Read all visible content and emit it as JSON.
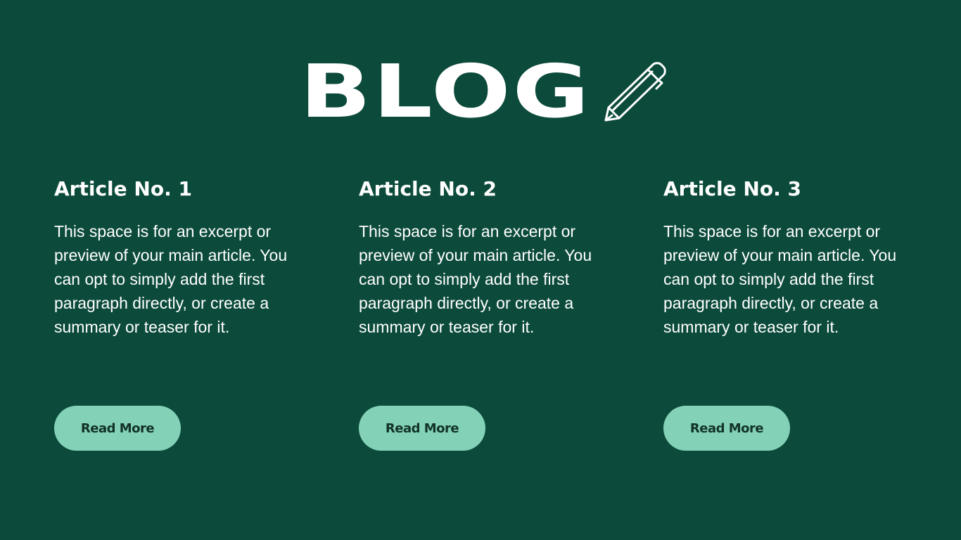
{
  "header": {
    "title": "BLOG",
    "icon": "pencil-icon"
  },
  "articles": [
    {
      "title": "Article No. 1",
      "excerpt": "This space is for an excerpt or preview of your main article. You can opt to simply add the first paragraph directly, or create a summary or teaser for it.",
      "button_label": "Read More"
    },
    {
      "title": "Article No. 2",
      "excerpt": "This space is for an excerpt or preview of your main article. You can opt to simply add the first paragraph directly, or create a summary or teaser for it.",
      "button_label": "Read More"
    },
    {
      "title": "Article No. 3",
      "excerpt": "This space is for an excerpt or preview of your main article. You can opt to simply add the first paragraph directly, or create a summary or teaser for it.",
      "button_label": "Read More"
    }
  ],
  "colors": {
    "background": "#0c4b3b",
    "button": "#83d1b7",
    "button_text": "#123327",
    "text": "#ffffff"
  }
}
